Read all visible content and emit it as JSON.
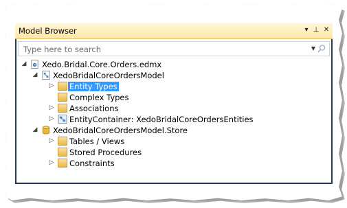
{
  "panel": {
    "title": "Model Browser",
    "buttons": {
      "dropdown": "▾",
      "pin": "⊥",
      "close": "✕"
    }
  },
  "search": {
    "placeholder": "Type here to search"
  },
  "tree": {
    "root": "Xedo.Bridal.Core.Orders.edmx",
    "model": "XedoBridalCoreOrdersModel",
    "entity_types": "Entity Types",
    "complex_types": "Complex Types",
    "associations": "Associations",
    "entity_container": "EntityContainer: XedoBridalCoreOrdersEntities",
    "store": "XedoBridalCoreOrdersModel.Store",
    "tables_views": "Tables / Views",
    "stored_procedures": "Stored Procedures",
    "constraints": "Constraints"
  },
  "colors": {
    "selection": "#3399ff",
    "titlebar": "#ffe8a6",
    "frame": "#293955"
  }
}
